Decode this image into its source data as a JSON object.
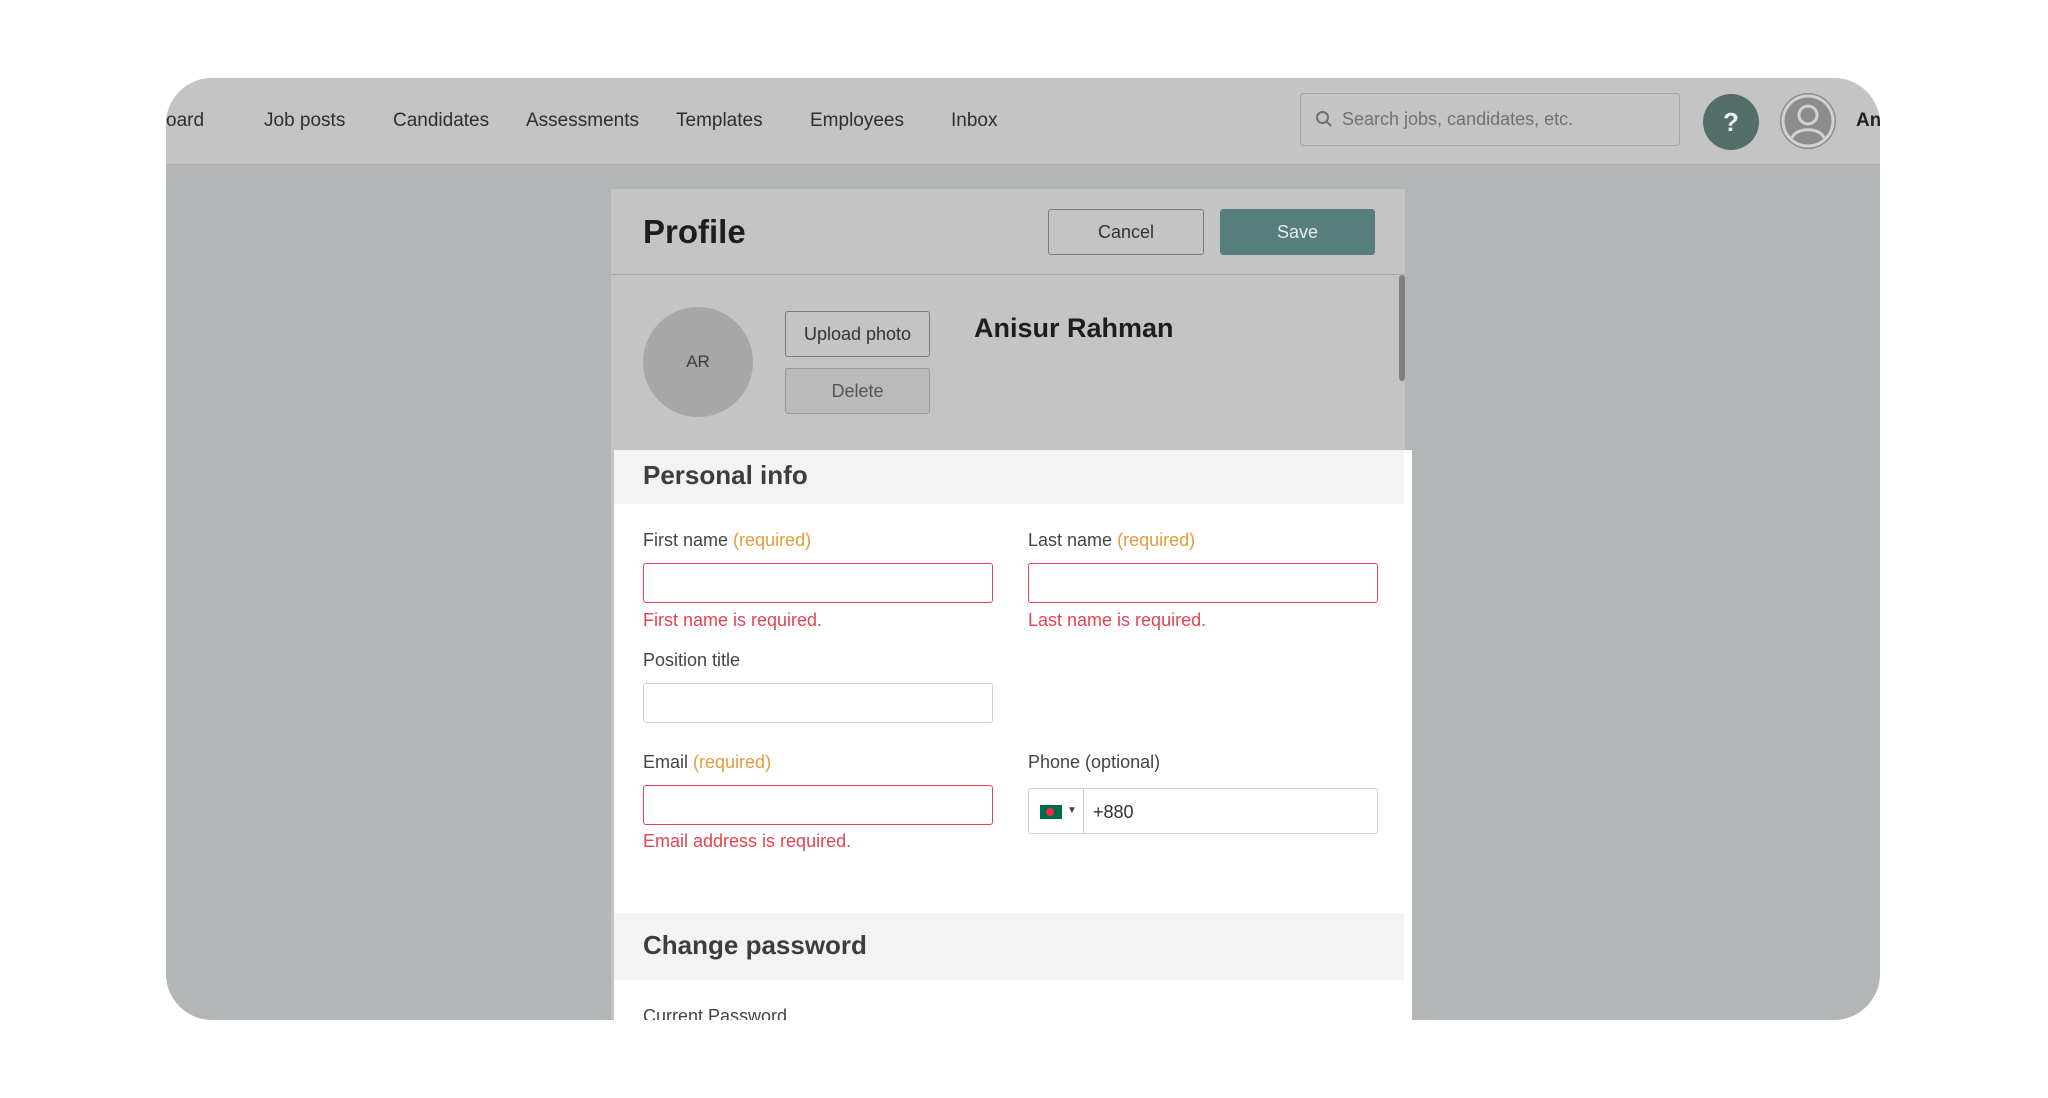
{
  "nav": {
    "items": [
      "oard",
      "Job posts",
      "Candidates",
      "Assessments",
      "Templates",
      "Employees",
      "Inbox"
    ],
    "search_placeholder": "Search jobs, candidates, etc.",
    "help_label": "?",
    "user_short": "Ani"
  },
  "modal": {
    "title": "Profile",
    "cancel_label": "Cancel",
    "save_label": "Save",
    "avatar_initials": "AR",
    "upload_label": "Upload photo",
    "delete_label": "Delete",
    "full_name": "Anisur Rahman"
  },
  "personal_info": {
    "title": "Personal info",
    "required_tag": "(required)",
    "first_name_label": "First name",
    "first_name_value": "",
    "first_name_error": "First name is required.",
    "last_name_label": "Last name",
    "last_name_value": "",
    "last_name_error": "Last name is required.",
    "position_label": "Position title",
    "position_value": "",
    "email_label": "Email",
    "email_value": "",
    "email_error": "Email address is required.",
    "phone_label": "Phone (optional)",
    "phone_value": "+880"
  },
  "change_password": {
    "title": "Change password",
    "current_label": "Current Password"
  },
  "colors": {
    "accent": "#587e7b",
    "error": "#e3444f",
    "required": "#e89a3c"
  }
}
